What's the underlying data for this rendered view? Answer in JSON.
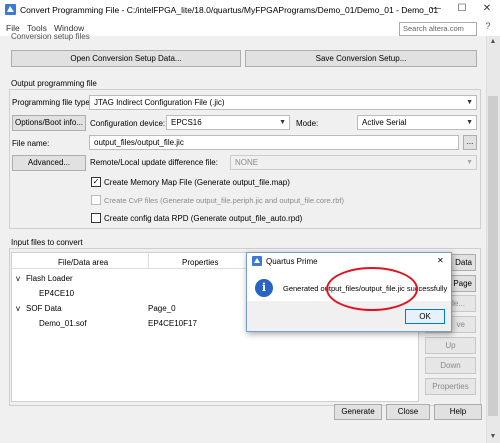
{
  "window": {
    "title": "Convert Programming File - C:/intelFPGA_lite/18.0/quartus/MyFPGAPrograms/Demo_01/Demo_01 - Demo_01",
    "minimize": "—",
    "maximize": "☐",
    "close": "✕"
  },
  "menu": {
    "items": [
      "File",
      "Tools",
      "Window"
    ],
    "search_placeholder": "Search altera.com",
    "help": "?"
  },
  "setup": {
    "partial_header": "Conversion setup files",
    "open_btn": "Open Conversion Setup Data...",
    "save_btn": "Save Conversion Setup..."
  },
  "output": {
    "header": "Output programming file",
    "type_label": "Programming file type:",
    "type_value": "JTAG Indirect Configuration File (.jic)",
    "options_btn": "Options/Boot info...",
    "device_label": "Configuration device:",
    "device_value": "EPCS16",
    "mode_label": "Mode:",
    "mode_value": "Active Serial",
    "filename_label": "File name:",
    "filename_value": "output_files/output_file.jic",
    "browse_btn": "...",
    "advanced_btn": "Advanced...",
    "remote_label": "Remote/Local update difference file:",
    "remote_value": "NONE",
    "cb_map": "Create Memory Map File (Generate output_file.map)",
    "cb_map_checked": "✓",
    "cb_cvp": "Create CvP files (Generate output_file.periph.jic and output_file.core.rbf)",
    "cb_rpd": "Create config data RPD (Generate output_file_auto.rpd)"
  },
  "input": {
    "header": "Input files to convert",
    "col_file": "File/Data area",
    "col_props": "Properties",
    "rows": [
      {
        "expander": "v",
        "name": "Flash Loader",
        "props": ""
      },
      {
        "expander": "",
        "name": "EP4CE10",
        "props": ""
      },
      {
        "expander": "v",
        "name": "SOF Data",
        "props": "Page_0"
      },
      {
        "expander": "",
        "name": "Demo_01.sof",
        "props": "EP4CE10F17"
      }
    ],
    "side_buttons": [
      "Data",
      "Page",
      "le...",
      "ve",
      "Up",
      "Down",
      "Properties"
    ]
  },
  "footer": {
    "generate": "Generate",
    "close": "Close",
    "help": "Help"
  },
  "dialog": {
    "title": "Quartus Prime",
    "close": "✕",
    "icon_glyph": "i",
    "message": "Generated output_files/output_file.jic successfully",
    "ok": "OK"
  },
  "colors": {
    "annotation_red": "#e0141e",
    "info_blue": "#2a63c6",
    "ok_border": "#0078d7"
  }
}
